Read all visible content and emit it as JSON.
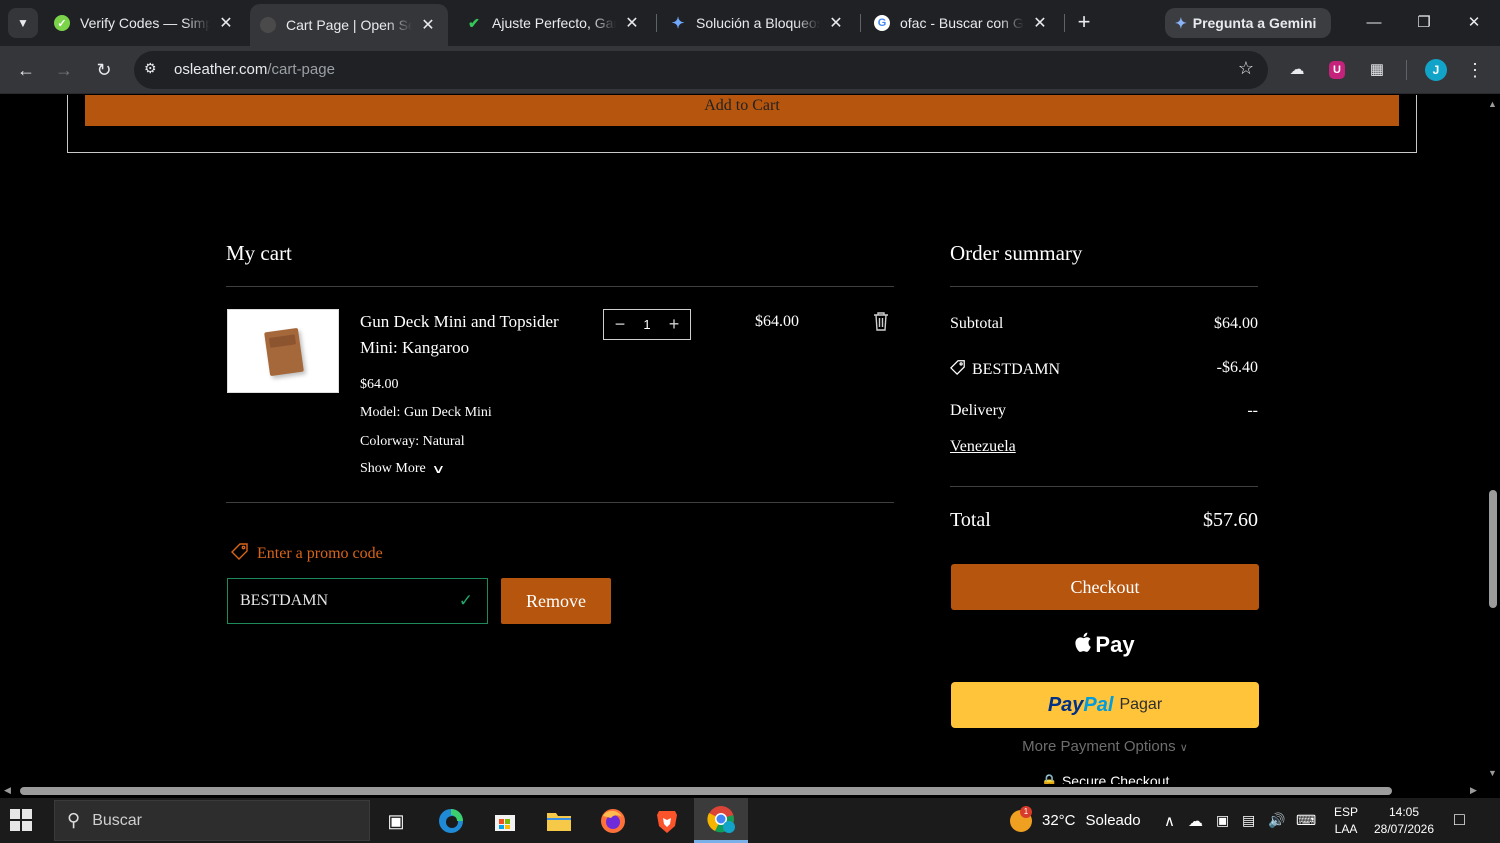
{
  "browser": {
    "tabs": [
      {
        "title": "Verify Codes — SimplyCodes",
        "icon": "simplycodes-icon",
        "active": false
      },
      {
        "title": "Cart Page | Open Sea Leather",
        "icon": "site-icon",
        "active": true
      },
      {
        "title": "Ajuste Perfecto, Garantizado",
        "icon": "check-icon",
        "active": false
      },
      {
        "title": "Solución a Bloqueos de",
        "icon": "gemini-icon",
        "active": false
      },
      {
        "title": "ofac - Buscar con Google",
        "icon": "google-icon",
        "active": false
      }
    ],
    "gemini_label": "Pregunta a Gemini",
    "url_host": "osleather.com",
    "url_path": "/cart-page",
    "profile_initial": "J"
  },
  "product": {
    "add_to_cart_label": "Add to Cart"
  },
  "cart": {
    "title": "My cart",
    "item": {
      "name": "Gun Deck Mini and Topsider Mini: Kangaroo",
      "unit_price": "$64.00",
      "model": "Model: Gun Deck Mini",
      "colorway": "Colorway: Natural",
      "show_more": "Show More",
      "quantity": "1",
      "line_price": "$64.00"
    },
    "promo": {
      "link_label": "Enter a promo code",
      "code": "BESTDAMN",
      "remove_label": "Remove"
    }
  },
  "summary": {
    "title": "Order summary",
    "subtotal_label": "Subtotal",
    "subtotal_value": "$64.00",
    "discount_label": "BESTDAMN",
    "discount_value": "-$6.40",
    "delivery_label": "Delivery",
    "delivery_value": "--",
    "country": "Venezuela",
    "total_label": "Total",
    "total_value": "$57.60",
    "checkout_label": "Checkout",
    "applepay_label": "Pay",
    "paypal_brand_1": "Pay",
    "paypal_brand_2": "Pal",
    "paypal_label": "Pagar",
    "more_options": "More Payment Options",
    "secure_label": "Secure Checkout"
  },
  "taskbar": {
    "search_placeholder": "Buscar",
    "weather_temp": "32°C",
    "weather_desc": "Soleado",
    "weather_badge": "1",
    "lang_1": "ESP",
    "lang_2": "LAA",
    "time": "14:05",
    "date": "28/07/2026"
  },
  "colors": {
    "accent": "#b5550e",
    "promo_link": "#d8641a",
    "valid_green": "#1e8a5a",
    "paypal_yellow": "#ffc439"
  }
}
